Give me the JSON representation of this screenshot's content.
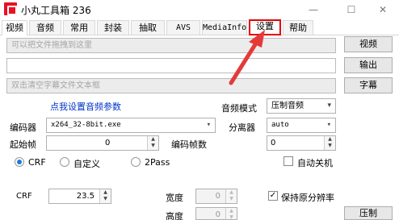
{
  "window": {
    "title": "小丸工具箱 236",
    "minimize": "—",
    "maximize": "☐",
    "close": "✕"
  },
  "tabs": [
    "视频",
    "音频",
    "常用",
    "封装",
    "抽取",
    "AVS",
    "MediaInfo",
    "设置",
    "帮助"
  ],
  "files": {
    "video_placeholder": "可以把文件拖拽到这里",
    "output_value": "",
    "subtitle_placeholder": "双击清空字幕文件文本框"
  },
  "buttons": {
    "video": "视频",
    "output": "输出",
    "subtitle": "字幕",
    "compress": "压制"
  },
  "audio": {
    "settings_link": "点我设置音频参数",
    "mode_label": "音频模式",
    "mode_value": "压制音频"
  },
  "encoder": {
    "label": "编码器",
    "value": "x264_32-8bit.exe",
    "demuxer_label": "分离器",
    "demuxer_value": "auto"
  },
  "frames": {
    "start_label": "起始帧",
    "start_value": "0",
    "count_label": "编码帧数",
    "count_value": "0"
  },
  "rate_mode": {
    "crf": "CRF",
    "custom": "自定义",
    "twopass": "2Pass",
    "selected": "CRF"
  },
  "auto_shutdown": "自动关机",
  "crf": {
    "label": "CRF",
    "value": "23.5"
  },
  "dimensions": {
    "width_label": "宽度",
    "width_value": "0",
    "height_label": "高度",
    "height_value": "0",
    "keep_res_label": "保持原分辨率",
    "keep_res_checked": true
  },
  "colors": {
    "highlight": "#e60000",
    "link": "#0033cc"
  }
}
